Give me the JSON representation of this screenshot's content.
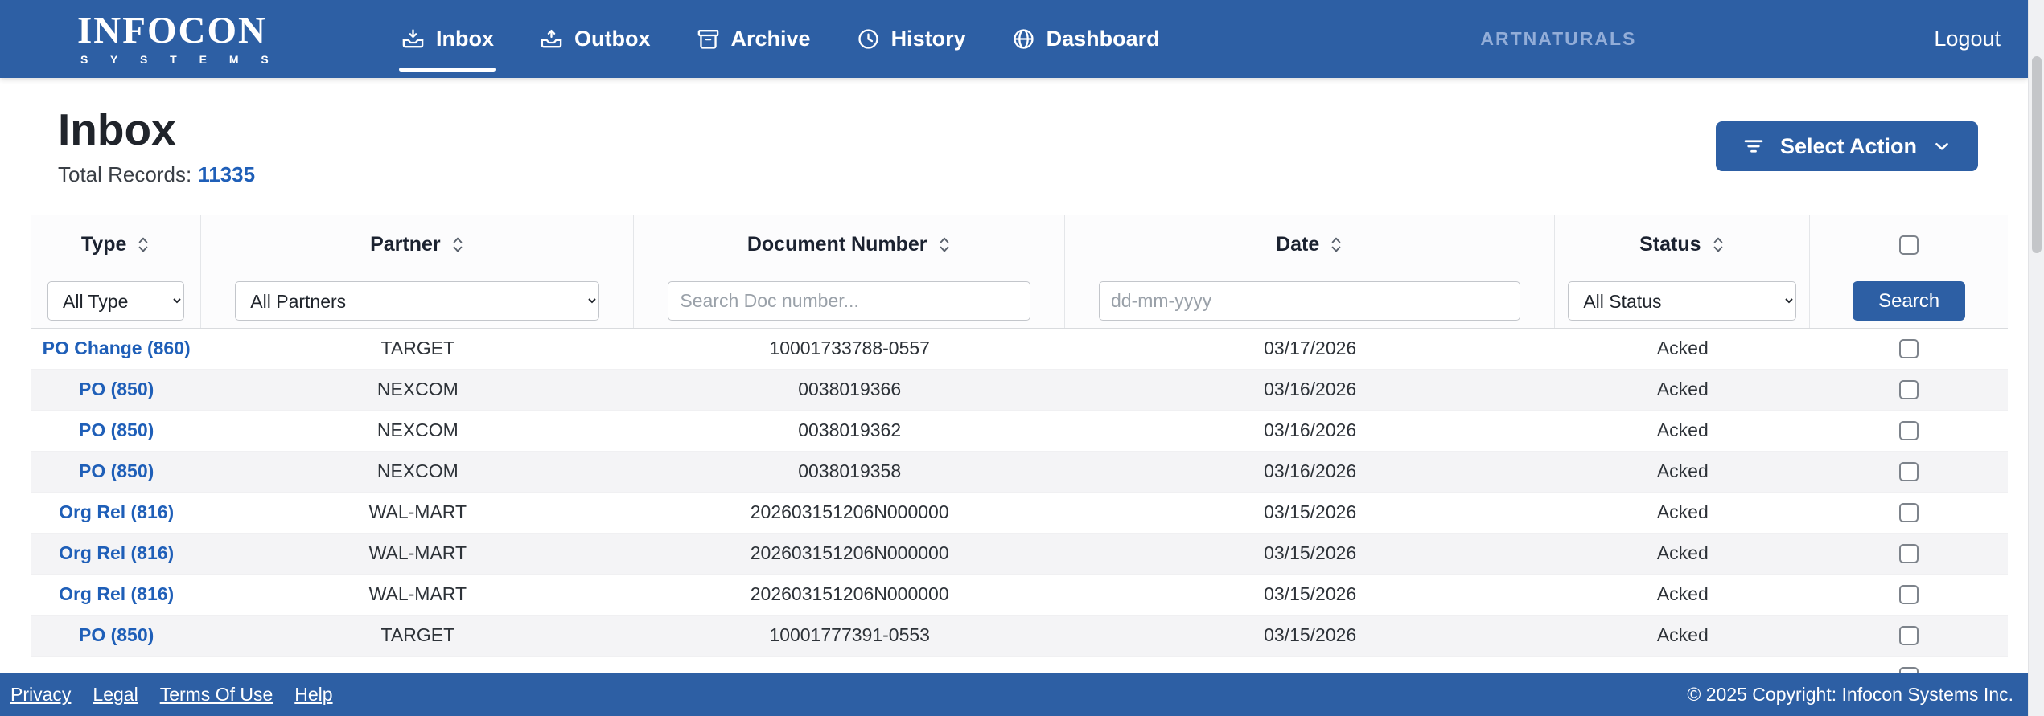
{
  "brand": {
    "name": "INFOCON",
    "subtitle": "S Y S T E M S"
  },
  "nav": {
    "items": [
      {
        "label": "Inbox"
      },
      {
        "label": "Outbox"
      },
      {
        "label": "Archive"
      },
      {
        "label": "History"
      },
      {
        "label": "Dashboard"
      }
    ],
    "account": "ARTNATURALS",
    "logout": "Logout"
  },
  "page": {
    "title": "Inbox",
    "total_label": "Total Records:",
    "total_value": "11335",
    "select_action_label": "Select Action"
  },
  "filters": {
    "type_value": "All Type",
    "partner_value": "All Partners",
    "doc_placeholder": "Search Doc number...",
    "date_placeholder": "dd-mm-yyyy",
    "status_value": "All Status",
    "search_label": "Search"
  },
  "table": {
    "headers": [
      "Type",
      "Partner",
      "Document Number",
      "Date",
      "Status"
    ],
    "rows": [
      {
        "type": "PO Change (860)",
        "partner": "TARGET",
        "doc_number": "10001733788-0557",
        "date": "03/17/2026",
        "status": "Acked"
      },
      {
        "type": "PO (850)",
        "partner": "NEXCOM",
        "doc_number": "0038019366",
        "date": "03/16/2026",
        "status": "Acked"
      },
      {
        "type": "PO (850)",
        "partner": "NEXCOM",
        "doc_number": "0038019362",
        "date": "03/16/2026",
        "status": "Acked"
      },
      {
        "type": "PO (850)",
        "partner": "NEXCOM",
        "doc_number": "0038019358",
        "date": "03/16/2026",
        "status": "Acked"
      },
      {
        "type": "Org Rel (816)",
        "partner": "WAL-MART",
        "doc_number": "202603151206N000000",
        "date": "03/15/2026",
        "status": "Acked"
      },
      {
        "type": "Org Rel (816)",
        "partner": "WAL-MART",
        "doc_number": "202603151206N000000",
        "date": "03/15/2026",
        "status": "Acked"
      },
      {
        "type": "Org Rel (816)",
        "partner": "WAL-MART",
        "doc_number": "202603151206N000000",
        "date": "03/15/2026",
        "status": "Acked"
      },
      {
        "type": "PO (850)",
        "partner": "TARGET",
        "doc_number": "10001777391-0553",
        "date": "03/15/2026",
        "status": "Acked"
      },
      {
        "type": "",
        "partner": "",
        "doc_number": "",
        "date": "",
        "status": ""
      }
    ]
  },
  "footer": {
    "links": [
      "Privacy",
      "Legal",
      "Terms Of Use",
      "Help"
    ],
    "copyright": "© 2025 Copyright: Infocon Systems Inc."
  },
  "colors": {
    "primary": "#2d5fa4",
    "link": "#1f5fb8",
    "account_text": "#92add8"
  }
}
